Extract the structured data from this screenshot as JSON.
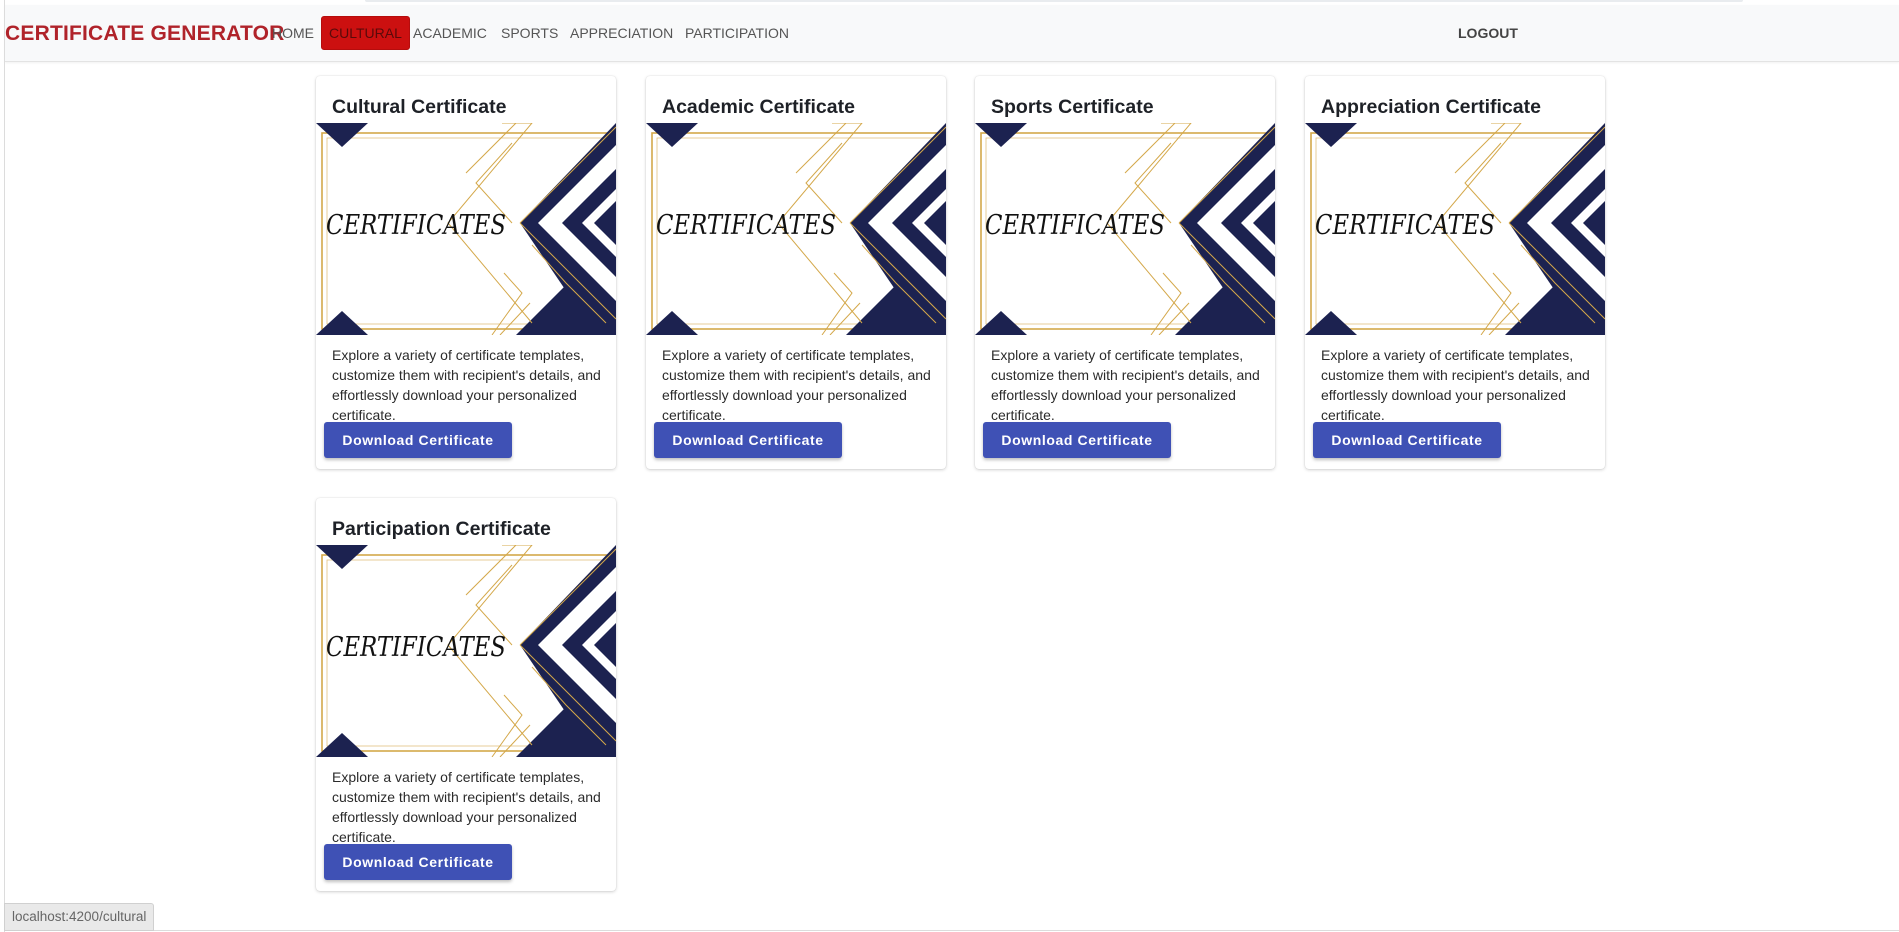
{
  "navbar": {
    "brand": "CERTIFICATE GENERATOR",
    "links": [
      "HOME",
      "CULTURAL",
      "ACADEMIC",
      "SPORTS",
      "APPRECIATION",
      "PARTICIPATION"
    ],
    "active_link": "CULTURAL",
    "logout": "LOGOUT"
  },
  "cards": [
    {
      "title": "Cultural Certificate",
      "image_text": "CERTIFICATES",
      "description": "Explore a variety of certificate templates, customize them with recipient's details, and effortlessly download your personalized certificate.",
      "button": "Download Certificate"
    },
    {
      "title": "Academic Certificate",
      "image_text": "CERTIFICATES",
      "description": "Explore a variety of certificate templates, customize them with recipient's details, and effortlessly download your personalized certificate.",
      "button": "Download Certificate"
    },
    {
      "title": "Sports Certificate",
      "image_text": "CERTIFICATES",
      "description": "Explore a variety of certificate templates, customize them with recipient's details, and effortlessly download your personalized certificate.",
      "button": "Download Certificate"
    },
    {
      "title": "Appreciation Certificate",
      "image_text": "CERTIFICATES",
      "description": "Explore a variety of certificate templates, customize them with recipient's details, and effortlessly download your personalized certificate.",
      "button": "Download Certificate"
    },
    {
      "title": "Participation Certificate",
      "image_text": "CERTIFICATES",
      "description": "Explore a variety of certificate templates, customize them with recipient's details, and effortlessly download your personalized certificate.",
      "button": "Download Certificate"
    }
  ],
  "status_bar": {
    "url": "localhost:4200/cultural"
  },
  "colors": {
    "brand": "#b0232a",
    "active_nav_bg": "#cc1010",
    "button": "#3f51b5",
    "certificate_navy": "#1c2250",
    "certificate_gold": "#d4a84a"
  }
}
